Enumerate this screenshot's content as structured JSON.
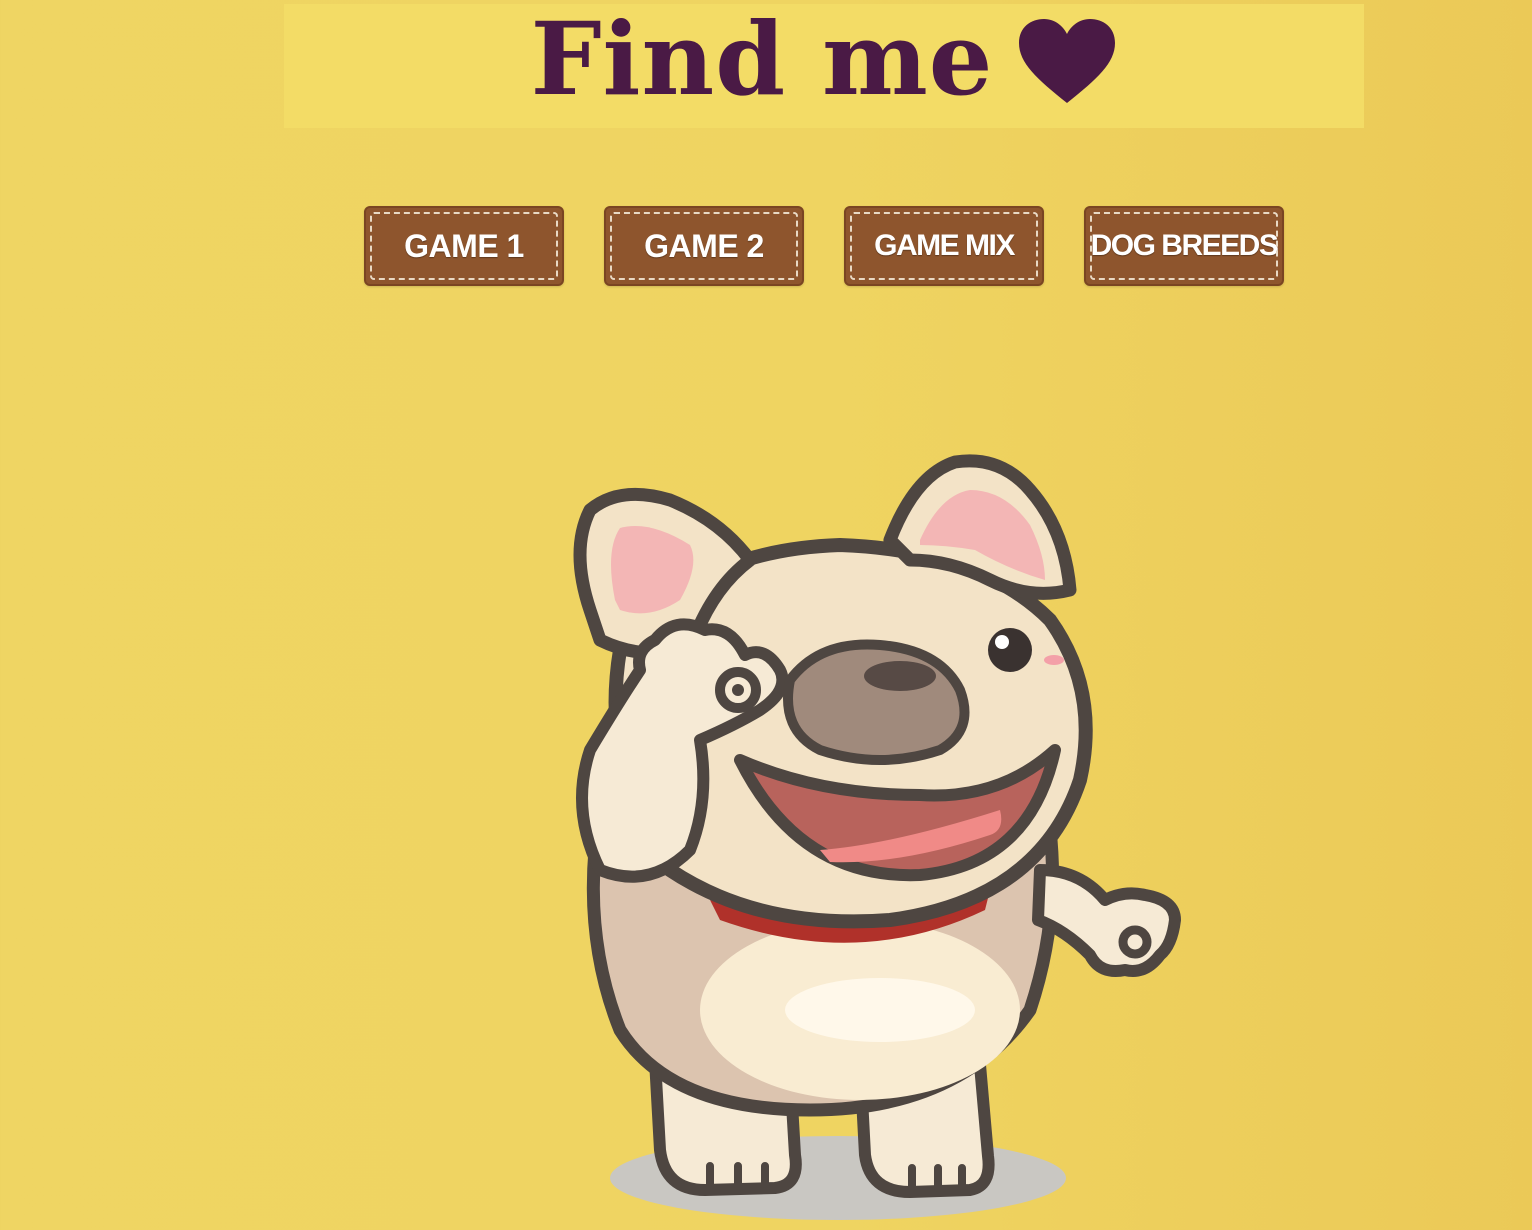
{
  "header": {
    "title": "Find me",
    "heart_icon": "heart-icon",
    "title_color": "#4a1a45",
    "background": "#f3dc66"
  },
  "nav": {
    "buttons": [
      {
        "label": "GAME 1"
      },
      {
        "label": "GAME 2"
      },
      {
        "label": "GAME MIX"
      },
      {
        "label": "DOG BREEDS"
      }
    ],
    "button_color": "#8e552d"
  },
  "mascot": {
    "icon": "french-bulldog-waving-icon"
  },
  "page_background": "#efd461"
}
